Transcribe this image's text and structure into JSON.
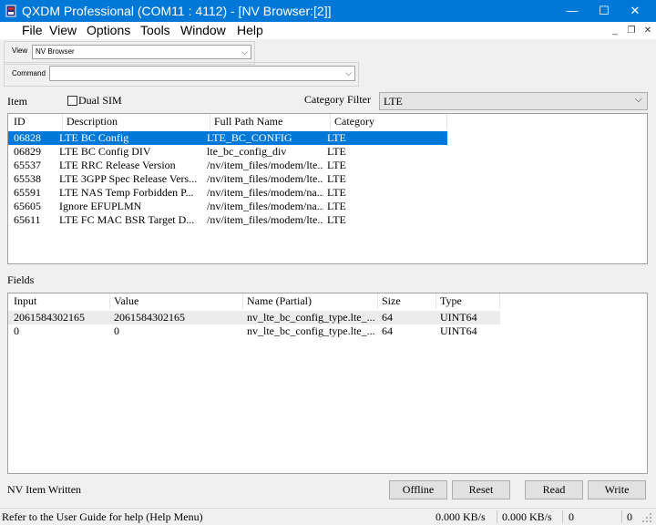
{
  "window": {
    "title": "QXDM Professional (COM11 : 4112) - [NV Browser:[2]]",
    "minimize": "—",
    "maximize": "☐",
    "close": "✕"
  },
  "menu": [
    "File",
    "View",
    "Options",
    "Tools",
    "Window",
    "Help"
  ],
  "mdi": {
    "minimize": "_",
    "restore": "❐",
    "close": "✕"
  },
  "toolbar": {
    "view_label": "View",
    "view_value": "NV Browser",
    "command_label": "Command",
    "command_value": ""
  },
  "item_section": {
    "label": "Item",
    "dual_sim_label": "Dual SIM",
    "dual_sim_checked": false,
    "category_filter_label": "Category Filter",
    "category_filter_value": "LTE"
  },
  "items_table": {
    "columns": [
      "ID",
      "Description",
      "Full Path Name",
      "Category"
    ],
    "rows": [
      [
        "06828",
        "LTE BC Config",
        "LTE_BC_CONFIG",
        "LTE"
      ],
      [
        "06829",
        "LTE BC Config DIV",
        "lte_bc_config_div",
        "LTE"
      ],
      [
        "65537",
        "LTE RRC Release Version",
        "/nv/item_files/modem/lte...",
        "LTE"
      ],
      [
        "65538",
        "LTE 3GPP Spec Release Vers...",
        "/nv/item_files/modem/lte...",
        "LTE"
      ],
      [
        "65591",
        "LTE NAS Temp Forbidden P...",
        "/nv/item_files/modem/na...",
        "LTE"
      ],
      [
        "65605",
        "Ignore EFUPLMN",
        "/nv/item_files/modem/na...",
        "LTE"
      ],
      [
        "65611",
        "LTE FC MAC BSR Target D...",
        "/nv/item_files/modem/lte...",
        "LTE"
      ]
    ],
    "selected_index": 0
  },
  "fields_section": {
    "label": "Fields",
    "columns": [
      "Input",
      "Value",
      "Name (Partial)",
      "Size",
      "Type"
    ],
    "rows": [
      [
        "2061584302165",
        "2061584302165",
        "nv_lte_bc_config_type.lte_...",
        "64",
        "UINT64"
      ],
      [
        "0",
        "0",
        "nv_lte_bc_config_type.lte_...",
        "64",
        "UINT64"
      ]
    ]
  },
  "status_message": "NV Item Written",
  "buttons": {
    "offline": "Offline",
    "reset": "Reset",
    "read": "Read",
    "write": "Write"
  },
  "statusbar": {
    "help_text": "Refer to the User Guide for help (Help Menu)",
    "rate1": "0.000 KB/s",
    "rate2": "0.000 KB/s",
    "count1": "0",
    "count2": "0"
  },
  "colors": {
    "titlebar": "#0078d7",
    "selection": "#0078d7"
  }
}
